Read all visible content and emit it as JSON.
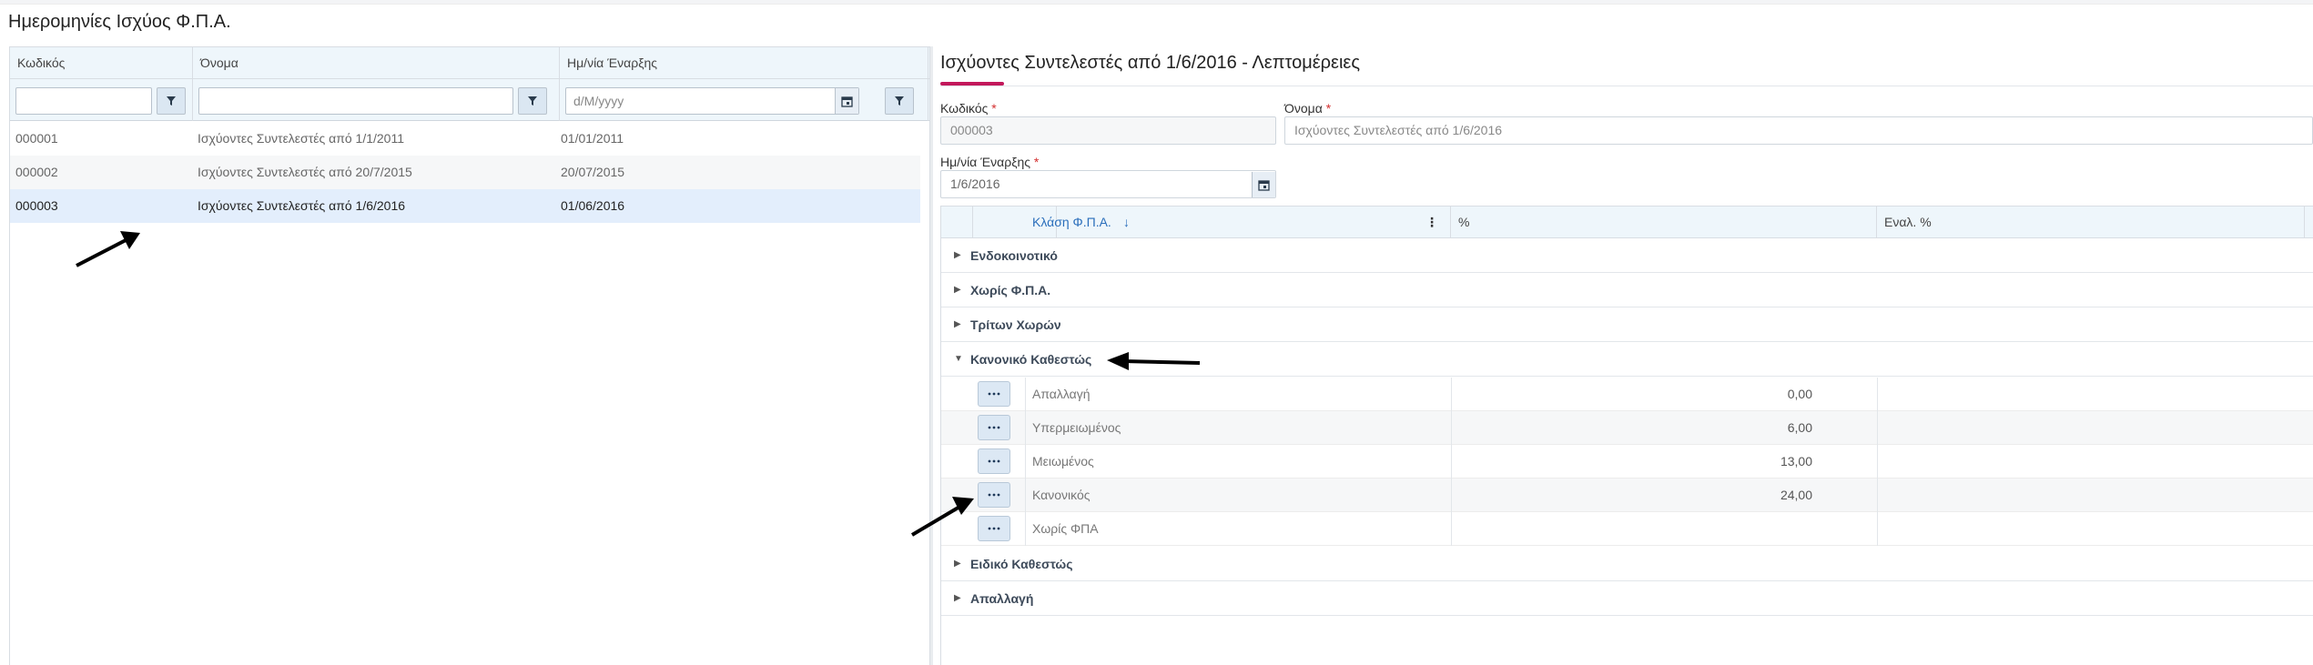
{
  "page": {
    "title": "Ημερομηνίες Ισχύος Φ.Π.Α."
  },
  "list": {
    "columns": [
      "Κωδικός",
      "Όνομα",
      "Ημ/νία Έναρξης"
    ],
    "date_placeholder": "d/M/yyyy",
    "rows": [
      {
        "code": "000001",
        "name": "Ισχύοντες Συντελεστές από 1/1/2011",
        "date": "01/01/2011"
      },
      {
        "code": "000002",
        "name": "Ισχύοντες Συντελεστές από 20/7/2015",
        "date": "20/07/2015"
      },
      {
        "code": "000003",
        "name": "Ισχύοντες Συντελεστές από 1/6/2016",
        "date": "01/06/2016"
      }
    ],
    "selected_index": 2
  },
  "details": {
    "title": "Ισχύοντες Συντελεστές από 1/6/2016 - Λεπτομέρειες",
    "code_label": "Κωδικός",
    "code_value": "000003",
    "name_label": "Όνομα",
    "name_value": "Ισχύοντες Συντελεστές από 1/6/2016",
    "date_label": "Ημ/νία Έναρξης",
    "date_value": "1/6/2016",
    "required_mark": "*",
    "accent_color": "#c2185b"
  },
  "grid": {
    "columns": {
      "class": "Κλάση Φ.Π.Α.",
      "percent": "%",
      "alt_percent": "Εναλ. %"
    },
    "groups": [
      {
        "label": "Ενδοκοινοτικό",
        "expanded": false
      },
      {
        "label": "Χωρίς Φ.Π.Α.",
        "expanded": false
      },
      {
        "label": "Τρίτων Χωρών",
        "expanded": false
      },
      {
        "label": "Κανονικό Καθεστώς",
        "expanded": true
      },
      {
        "label": "Ειδικό Καθεστώς",
        "expanded": false
      },
      {
        "label": "Απαλλαγή",
        "expanded": false
      }
    ],
    "sub_rows": [
      {
        "name": "Απαλλαγή",
        "percent": "0,00"
      },
      {
        "name": "Υπερμειωμένος",
        "percent": "6,00"
      },
      {
        "name": "Μειωμένος",
        "percent": "13,00"
      },
      {
        "name": "Κανονικός",
        "percent": "24,00"
      },
      {
        "name": "Χωρίς ΦΠΑ",
        "percent": ""
      }
    ]
  }
}
